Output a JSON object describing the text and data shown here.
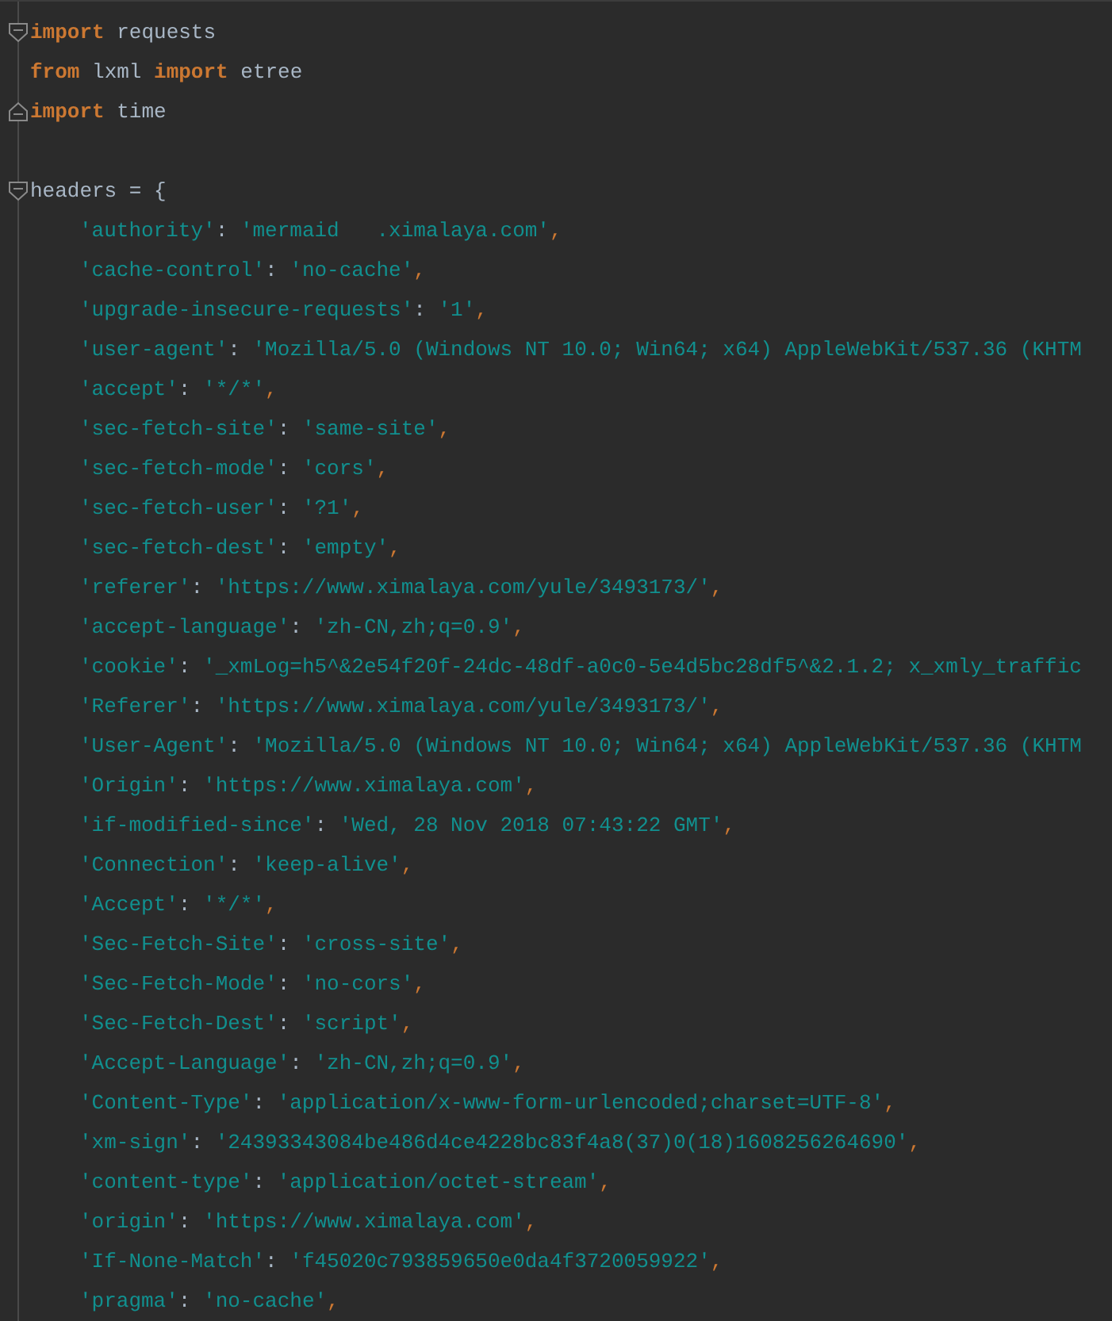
{
  "lines": [
    {
      "fold_open": true,
      "tokens": [
        {
          "kind": "keyword",
          "text": "import"
        },
        {
          "kind": "name",
          "text": "requests"
        }
      ]
    },
    {
      "tokens": [
        {
          "kind": "keyword",
          "text": "from"
        },
        {
          "kind": "name",
          "text": "lxml"
        },
        {
          "kind": "keyword",
          "text": "import"
        },
        {
          "kind": "name",
          "text": "etree"
        }
      ]
    },
    {
      "fold_close": true,
      "tokens": [
        {
          "kind": "keyword",
          "text": "import"
        },
        {
          "kind": "name",
          "text": "time"
        }
      ]
    }
  ],
  "headers": {
    "fold_open": true,
    "tokens": [
      {
        "kind": "name",
        "text": "headers"
      },
      {
        "kind": "name",
        "text": "="
      },
      {
        "kind": "name",
        "text": "{"
      }
    ],
    "entries": [
      {
        "key": "'authority'",
        "colon": ":",
        "value": "'mermaid   .ximalaya.com'",
        "comma": ","
      },
      {
        "key": "'cache-control'",
        "colon": ":",
        "value": "'no-cache'",
        "comma": ","
      },
      {
        "key": "'upgrade-insecure-requests'",
        "colon": ":",
        "value": "'1'",
        "comma": ","
      },
      {
        "key": "'user-agent'",
        "colon": ":",
        "value": "'Mozilla/5.0 (Windows NT 10.0; Win64; x64) AppleWebKit/537.36 (KHTM"
      },
      {
        "key": "'accept'",
        "colon": ":",
        "value": "'*/*'",
        "comma": ","
      },
      {
        "key": "'sec-fetch-site'",
        "colon": ":",
        "value": "'same-site'",
        "comma": ","
      },
      {
        "key": "'sec-fetch-mode'",
        "colon": ":",
        "value": "'cors'",
        "comma": ","
      },
      {
        "key": "'sec-fetch-user'",
        "colon": ":",
        "value": "'?1'",
        "comma": ","
      },
      {
        "key": "'sec-fetch-dest'",
        "colon": ":",
        "value": "'empty'",
        "comma": ","
      },
      {
        "key": "'referer'",
        "colon": ":",
        "value": "'https://www.ximalaya.com/yule/3493173/'",
        "comma": ","
      },
      {
        "key": "'accept-language'",
        "colon": ":",
        "value": "'zh-CN,zh;q=0.9'",
        "comma": ","
      },
      {
        "key": "'cookie'",
        "colon": ":",
        "value": "'_xmLog=h5^&2e54f20f-24dc-48df-a0c0-5e4d5bc28df5^&2.1.2; x_xmly_traffic"
      },
      {
        "key": "'Referer'",
        "colon": ":",
        "value": "'https://www.ximalaya.com/yule/3493173/'",
        "comma": ","
      },
      {
        "key": "'User-Agent'",
        "colon": ":",
        "value": "'Mozilla/5.0 (Windows NT 10.0; Win64; x64) AppleWebKit/537.36 (KHTM"
      },
      {
        "key": "'Origin'",
        "colon": ":",
        "value": "'https://www.ximalaya.com'",
        "comma": ","
      },
      {
        "key": "'if-modified-since'",
        "colon": ":",
        "value": "'Wed, 28 Nov 2018 07:43:22 GMT'",
        "comma": ","
      },
      {
        "key": "'Connection'",
        "colon": ":",
        "value": "'keep-alive'",
        "comma": ","
      },
      {
        "key": "'Accept'",
        "colon": ":",
        "value": "'*/*'",
        "comma": ","
      },
      {
        "key": "'Sec-Fetch-Site'",
        "colon": ":",
        "value": "'cross-site'",
        "comma": ","
      },
      {
        "key": "'Sec-Fetch-Mode'",
        "colon": ":",
        "value": "'no-cors'",
        "comma": ","
      },
      {
        "key": "'Sec-Fetch-Dest'",
        "colon": ":",
        "value": "'script'",
        "comma": ","
      },
      {
        "key": "'Accept-Language'",
        "colon": ":",
        "value": "'zh-CN,zh;q=0.9'",
        "comma": ","
      },
      {
        "key": "'Content-Type'",
        "colon": ":",
        "value": "'application/x-www-form-urlencoded;charset=UTF-8'",
        "comma": ","
      },
      {
        "key": "'xm-sign'",
        "colon": ":",
        "value": "'24393343084be486d4ce4228bc83f4a8(37)0(18)1608256264690'",
        "comma": ","
      },
      {
        "key": "'content-type'",
        "colon": ":",
        "value": "'application/octet-stream'",
        "comma": ","
      },
      {
        "key": "'origin'",
        "colon": ":",
        "value": "'https://www.ximalaya.com'",
        "comma": ","
      },
      {
        "key": "'If-None-Match'",
        "colon": ":",
        "value": "'f45020c793859650e0da4f3720059922'",
        "comma": ","
      },
      {
        "key": "'pragma'",
        "colon": ":",
        "value": "'no-cache'",
        "comma": ","
      }
    ]
  }
}
